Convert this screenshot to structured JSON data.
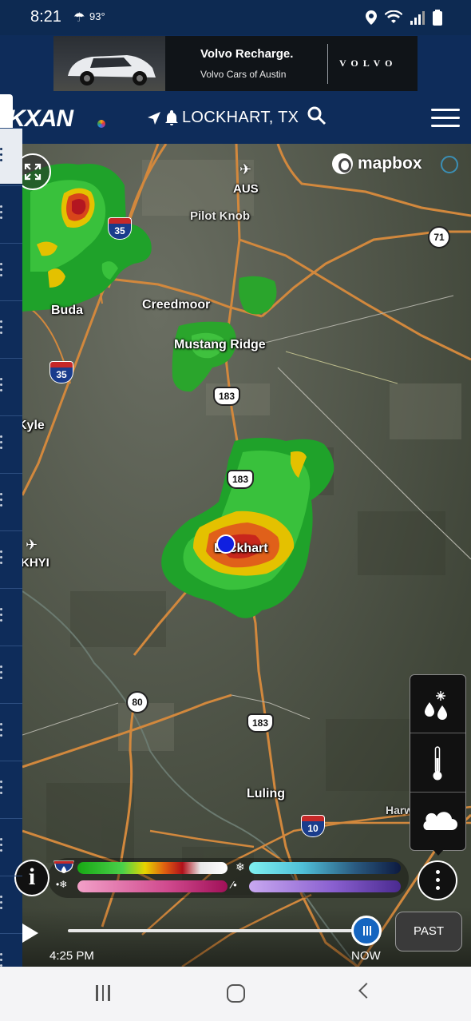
{
  "status_bar": {
    "time": "8:21",
    "temperature": "93°",
    "weather_icon": "thunder-person-icon",
    "icons": [
      "location-icon",
      "wifi-icon",
      "signal-icon",
      "battery-icon"
    ]
  },
  "ad": {
    "title": "Volvo Recharge.",
    "subtitle": "Volvo Cars of Austin",
    "brand": "VOLVO"
  },
  "header": {
    "logo": "KXAN",
    "location": "LOCKHART, TX",
    "icons": [
      "navigation-arrow-icon",
      "bell-icon",
      "search-icon",
      "hamburger-menu-icon"
    ]
  },
  "map": {
    "attribution": "mapbox",
    "places": {
      "aus": "AUS",
      "pilot_knob": "Pilot Knob",
      "buda": "Buda",
      "creedmoor": "Creedmoor",
      "mustang_ridge": "Mustang Ridge",
      "kyle": "Kyle",
      "khyi": "KHYI",
      "lockhart": "Lockhart",
      "luling": "Luling",
      "harwood": "Harwood"
    },
    "shields": {
      "i35_top": "35",
      "i35_bottom": "35",
      "tx71": "71",
      "us183_a": "183",
      "us183_b": "183",
      "us183_c": "183",
      "fm80": "80",
      "i10": "10"
    }
  },
  "layers": [
    "precip-mix-icon",
    "thermometer-icon",
    "cloud-icon"
  ],
  "legend": {
    "info_label": "i",
    "rain_icon": "rain-icon",
    "snow_icon": "snowflake-icon",
    "mix_icon": "mix-icon",
    "ice_icon": "ice-icon"
  },
  "timeline": {
    "start_time": "4:25 PM",
    "now_label": "NOW",
    "past_label": "PAST",
    "progress": 1.0
  },
  "nav_bar": [
    "recent-apps-icon",
    "home-icon",
    "back-icon"
  ]
}
